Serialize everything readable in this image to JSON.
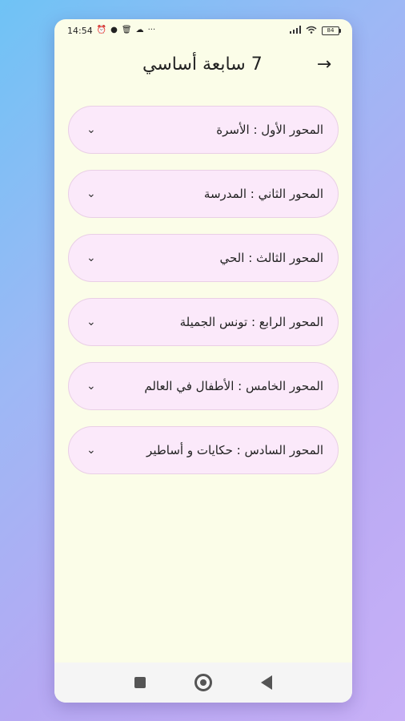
{
  "status": {
    "time": "14:54",
    "battery": "84",
    "icons": [
      "alarm-icon",
      "messenger-icon",
      "trash-icon",
      "cloud-icon",
      "more-icon",
      "signal-icon",
      "wifi-icon",
      "battery-icon"
    ]
  },
  "header": {
    "title": "7 سابعة أساسي",
    "back_icon": "arrow-right-icon"
  },
  "items": [
    {
      "label": "المحور الأول : الأسرة"
    },
    {
      "label": "المحور الثاني : المدرسة"
    },
    {
      "label": "المحور الثالث : الحي"
    },
    {
      "label": "المحور الرابع : تونس الجميلة"
    },
    {
      "label": "المحور الخامس : الأطفال في العالم"
    },
    {
      "label": "المحور السادس : حكايات و أساطير"
    }
  ],
  "colors": {
    "screen_bg": "#fbfde8",
    "item_bg": "#fbe9fa",
    "item_border": "#e9cfe6"
  }
}
